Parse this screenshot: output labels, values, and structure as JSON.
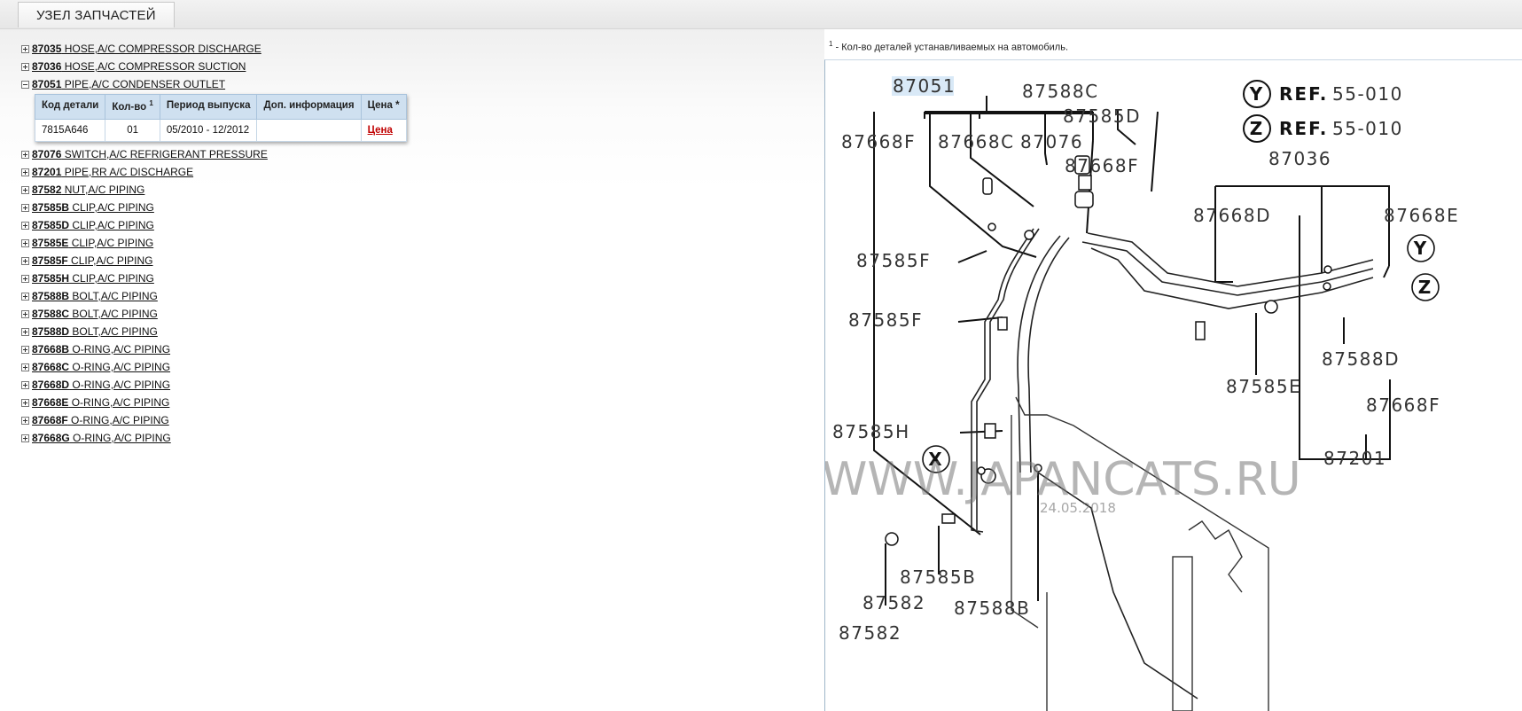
{
  "tab": {
    "title": "УЗЕЛ ЗАПЧАСТЕЙ"
  },
  "tree": [
    {
      "code": "87035",
      "name": " HOSE,A/C COMPRESSOR DISCHARGE",
      "expanded": false
    },
    {
      "code": "87036",
      "name": " HOSE,A/C COMPRESSOR SUCTION",
      "expanded": false
    },
    {
      "code": "87051",
      "name": " PIPE,A/C CONDENSER OUTLET",
      "expanded": true
    },
    {
      "code": "87076",
      "name": " SWITCH,A/C REFRIGERANT PRESSURE",
      "expanded": false
    },
    {
      "code": "87201",
      "name": " PIPE,RR A/C DISCHARGE",
      "expanded": false
    },
    {
      "code": "87582",
      "name": " NUT,A/C PIPING",
      "expanded": false
    },
    {
      "code": "87585B",
      "name": " CLIP,A/C PIPING",
      "expanded": false
    },
    {
      "code": "87585D",
      "name": " CLIP,A/C PIPING",
      "expanded": false
    },
    {
      "code": "87585E",
      "name": " CLIP,A/C PIPING",
      "expanded": false
    },
    {
      "code": "87585F",
      "name": " CLIP,A/C PIPING",
      "expanded": false
    },
    {
      "code": "87585H",
      "name": " CLIP,A/C PIPING",
      "expanded": false
    },
    {
      "code": "87588B",
      "name": " BOLT,A/C PIPING",
      "expanded": false
    },
    {
      "code": "87588C",
      "name": " BOLT,A/C PIPING",
      "expanded": false
    },
    {
      "code": "87588D",
      "name": " BOLT,A/C PIPING",
      "expanded": false
    },
    {
      "code": "87668B",
      "name": " O-RING,A/C PIPING",
      "expanded": false
    },
    {
      "code": "87668C",
      "name": " O-RING,A/C PIPING",
      "expanded": false
    },
    {
      "code": "87668D",
      "name": " O-RING,A/C PIPING",
      "expanded": false
    },
    {
      "code": "87668E",
      "name": " O-RING,A/C PIPING",
      "expanded": false
    },
    {
      "code": "87668F",
      "name": " O-RING,A/C PIPING",
      "expanded": false
    },
    {
      "code": "87668G",
      "name": " O-RING,A/C PIPING",
      "expanded": false
    }
  ],
  "parts_table": {
    "headers": {
      "code": "Код детали",
      "qty": "Кол-во",
      "qty_sup": "1",
      "period": "Период выпуска",
      "info": "Доп. информация",
      "price": "Цена *"
    },
    "rows": [
      {
        "code": "7815A646",
        "qty": "01",
        "period": "05/2010 - 12/2012",
        "info": "",
        "price": "Цена"
      }
    ]
  },
  "footnote": {
    "sup": "1",
    "text": " - Кол-во деталей устанавливаемых на автомобиль."
  },
  "diagram": {
    "labels": {
      "l87051": "87051",
      "l87588C": "87588C",
      "l87585D": "87585D",
      "l87668F_a": "87668F",
      "l87668C": "87668C",
      "l87076": "87076",
      "l87668F_b": "87668F",
      "l87036": "87036",
      "l87668D": "87668D",
      "l87668E": "87668E",
      "l87585F_a": "87585F",
      "l87585F_b": "87585F",
      "l87588D": "87588D",
      "l87585E": "87585E",
      "l87668F_c": "87668F",
      "l87585H": "87585H",
      "l87201": "87201",
      "l87585B": "87585B",
      "l87588B": "87588B",
      "l87582_a": "87582",
      "l87582_b": "87582"
    },
    "refs": [
      {
        "letter": "Y",
        "text": "REF.",
        "num": "55-010"
      },
      {
        "letter": "Z",
        "text": "REF.",
        "num": "55-010"
      }
    ],
    "callouts": {
      "x": "X",
      "y": "Y",
      "z": "Z"
    },
    "watermark": "WWW.JAPANCATS.RU",
    "watermark_date": "24.05.2018"
  }
}
